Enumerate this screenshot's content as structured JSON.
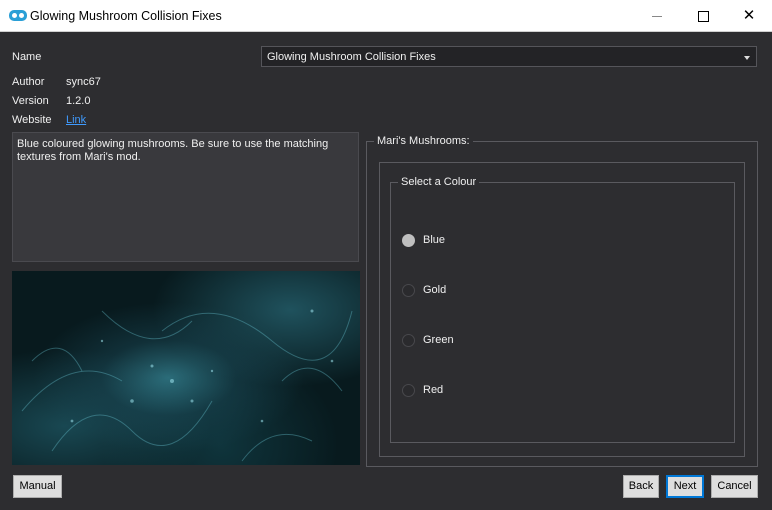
{
  "window": {
    "title": "Glowing Mushroom Collision Fixes"
  },
  "info": {
    "name_label": "Name",
    "name_value": "Glowing Mushroom Collision Fixes",
    "author_label": "Author",
    "author_value": "sync67",
    "version_label": "Version",
    "version_value": "1.2.0",
    "website_label": "Website",
    "website_link": "Link"
  },
  "description": "Blue coloured glowing mushrooms. Be sure to use the matching textures from Mari's mod.",
  "group": {
    "title": "Mari's Mushrooms:",
    "subgroup_title": "Select a Colour",
    "options": [
      {
        "label": "Blue",
        "checked": true
      },
      {
        "label": "Gold",
        "checked": false
      },
      {
        "label": "Green",
        "checked": false
      },
      {
        "label": "Red",
        "checked": false
      }
    ]
  },
  "buttons": {
    "manual": "Manual",
    "back": "Back",
    "next": "Next",
    "cancel": "Cancel"
  },
  "colors": {
    "accent": "#0078d7",
    "link": "#3f9bff",
    "background": "#2d2d30"
  },
  "icons": {
    "app": "mod-organizer-icon",
    "image": "glowing-mushroom-preview-image"
  }
}
